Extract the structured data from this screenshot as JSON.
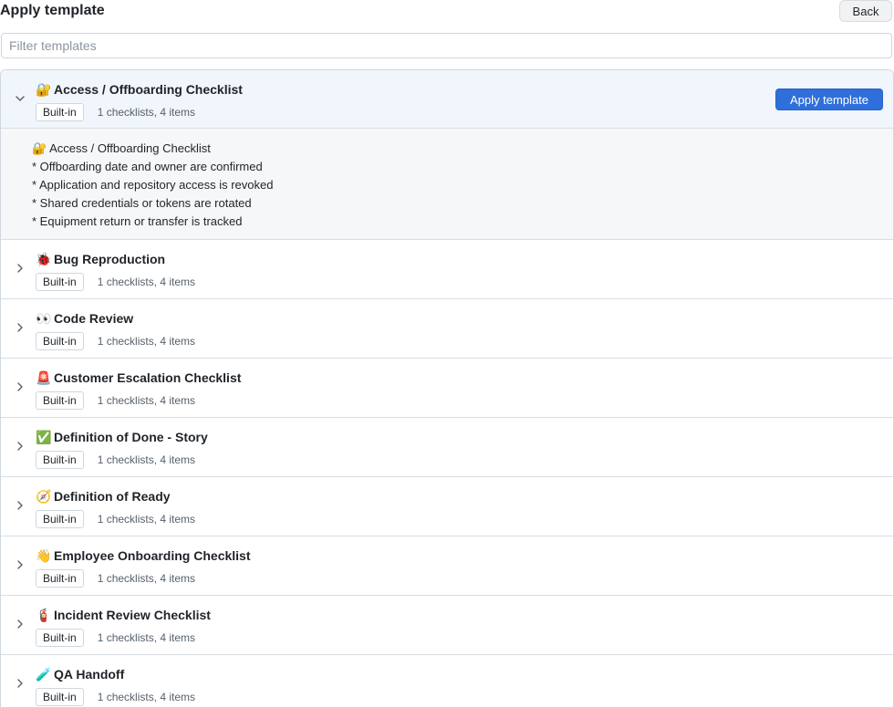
{
  "header": {
    "title": "Apply template",
    "back_label": "Back"
  },
  "filter": {
    "placeholder": "Filter templates",
    "value": ""
  },
  "templates": [
    {
      "emoji": "🔐",
      "name": "Access / Offboarding Checklist",
      "badge": "Built-in",
      "meta": "1 checklists, 4 items",
      "expanded": true,
      "apply_label": "Apply template",
      "preview": [
        "🔐 Access / Offboarding Checklist",
        "* Offboarding date and owner are confirmed",
        "* Application and repository access is revoked",
        "* Shared credentials or tokens are rotated",
        "* Equipment return or transfer is tracked"
      ]
    },
    {
      "emoji": "🐞",
      "name": "Bug Reproduction",
      "badge": "Built-in",
      "meta": "1 checklists, 4 items"
    },
    {
      "emoji": "👀",
      "name": "Code Review",
      "badge": "Built-in",
      "meta": "1 checklists, 4 items"
    },
    {
      "emoji": "🚨",
      "name": "Customer Escalation Checklist",
      "badge": "Built-in",
      "meta": "1 checklists, 4 items"
    },
    {
      "emoji": "✅",
      "name": "Definition of Done - Story",
      "badge": "Built-in",
      "meta": "1 checklists, 4 items"
    },
    {
      "emoji": "🧭",
      "name": "Definition of Ready",
      "badge": "Built-in",
      "meta": "1 checklists, 4 items"
    },
    {
      "emoji": "👋",
      "name": "Employee Onboarding Checklist",
      "badge": "Built-in",
      "meta": "1 checklists, 4 items"
    },
    {
      "emoji": "🧯",
      "name": "Incident Review Checklist",
      "badge": "Built-in",
      "meta": "1 checklists, 4 items"
    },
    {
      "emoji": "🧪",
      "name": "QA Handoff",
      "badge": "Built-in",
      "meta": "1 checklists, 4 items"
    }
  ],
  "colors": {
    "accent": "#2f6fdb",
    "expanded_row_bg": "#f1f5fc",
    "preview_bg": "#f6f7f9",
    "border": "#d0d7de"
  },
  "icons": {
    "expanded": "chevron-down-icon",
    "collapsed": "chevron-right-icon"
  }
}
